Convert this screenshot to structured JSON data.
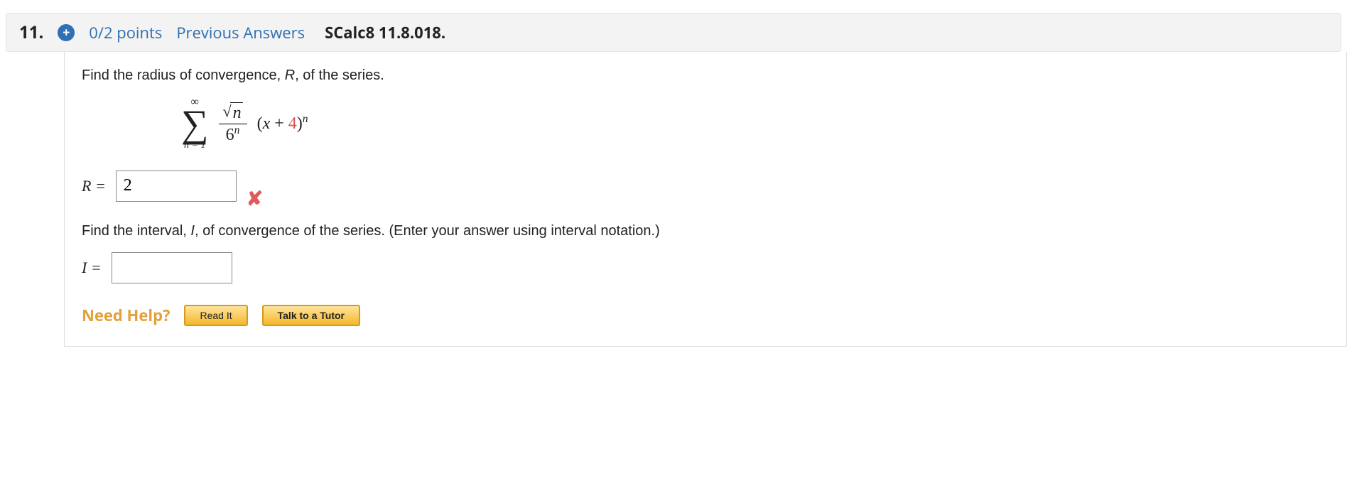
{
  "header": {
    "number": "11.",
    "plus": "+",
    "points": "0/2 points",
    "previous": "Previous Answers",
    "textbook": "SCalc8 11.8.018."
  },
  "body": {
    "prompt1_a": "Find the radius of convergence, ",
    "prompt1_R": "R",
    "prompt1_b": ", of the series.",
    "prompt2_a": "Find the interval, ",
    "prompt2_I": "I",
    "prompt2_b": ", of convergence of the series. (Enter your answer using interval notation.)"
  },
  "formula": {
    "sigma_top": "∞",
    "sigma_bot": "n = 1",
    "sqrt_arg": "n",
    "den_base": "6",
    "den_exp": "n",
    "factor_a": "(",
    "factor_x": "x",
    "factor_plus": " + ",
    "factor_c": "4",
    "factor_b": ")",
    "factor_exp": "n"
  },
  "answers": {
    "R_label": "R = ",
    "R_value": "2",
    "I_label": "I = ",
    "I_value": ""
  },
  "help": {
    "label": "Need Help?",
    "read": "Read It",
    "tutor": "Talk to a Tutor"
  },
  "icons": {
    "wrong": "✘"
  }
}
